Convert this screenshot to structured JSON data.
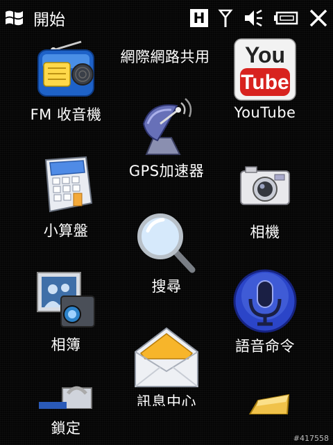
{
  "statusbar": {
    "start_label": "開始",
    "h_indicator": "H",
    "icons": [
      "windows-flag-icon",
      "h-network-icon",
      "signal-icon",
      "volume-muted-icon",
      "battery-icon",
      "close-icon"
    ]
  },
  "tiles": [
    {
      "id": "fm-radio",
      "label": "FM 收音機",
      "icon": "radio-icon"
    },
    {
      "id": "internet-sharing",
      "label": "網際網路共用",
      "icon": "satellite-dish-icon"
    },
    {
      "id": "youtube",
      "label": "YouTube",
      "icon": "youtube-icon"
    },
    {
      "id": "gps",
      "label": "GPS加速器",
      "icon": "satellite-dish-icon"
    },
    {
      "id": "calculator",
      "label": "小算盤",
      "icon": "calculator-icon"
    },
    {
      "id": "camera",
      "label": "相機",
      "icon": "camera-icon"
    },
    {
      "id": "search",
      "label": "搜尋",
      "icon": "magnifier-icon"
    },
    {
      "id": "album",
      "label": "相簿",
      "icon": "photo-album-icon"
    },
    {
      "id": "voice-command",
      "label": "語音命令",
      "icon": "microphone-icon"
    },
    {
      "id": "messaging",
      "label": "訊息中心",
      "icon": "envelope-icon"
    },
    {
      "id": "lock",
      "label": "鎖定",
      "icon": "lock-icon"
    }
  ],
  "watermark": "#417558",
  "colors": {
    "background": "#050505",
    "text": "#ffffff",
    "youtube_red": "#d8231f",
    "mic_blue": "#2b45c8"
  }
}
